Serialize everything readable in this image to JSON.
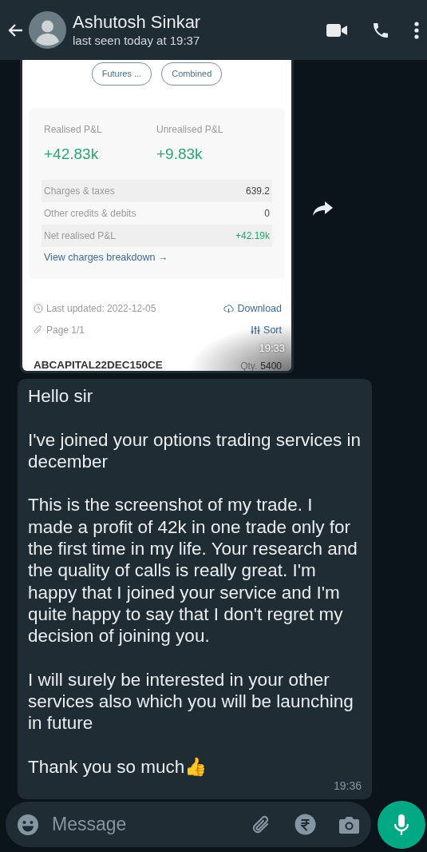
{
  "header": {
    "contact_name": "Ashutosh Sinkar",
    "status": "last seen today at 19:37"
  },
  "messages": [
    {
      "kind": "image",
      "time": "19:33",
      "screenshot": {
        "filters": [
          "Futures ...",
          "Combined"
        ],
        "summary": [
          {
            "label": "Realised P&L",
            "value": "+42.83k"
          },
          {
            "label": "Unrealised P&L",
            "value": "+9.83k"
          }
        ],
        "rows": [
          {
            "label": "Charges & taxes",
            "value": "639.2",
            "positive": false
          },
          {
            "label": "Other credits & debits",
            "value": "0",
            "positive": false
          },
          {
            "label": "Net realised P&L",
            "value": "+42.19k",
            "positive": true
          }
        ],
        "link": "View charges breakdown →",
        "last_updated": "Last updated: 2022-12-05",
        "download": "Download",
        "page": "Page 1/1",
        "sort": "Sort",
        "instrument": "ABCAPITAL22DEC150CE",
        "qty_label": "Qty.",
        "qty": "5400"
      }
    },
    {
      "kind": "text",
      "time": "19:36",
      "paragraphs": [
        "Hello sir",
        "I've joined your options trading services in december",
        "This is the screenshot of my trade. I made a profit of 42k in one trade only for the first time in my life. Your research and the quality of calls is really great. I'm happy that I joined your service and I'm quite happy to say that I don't regret my decision of joining you.",
        "I will surely be interested in your other services also which you will be launching in future",
        "Thank you so much👍"
      ]
    }
  ],
  "composer": {
    "placeholder": "Message"
  }
}
